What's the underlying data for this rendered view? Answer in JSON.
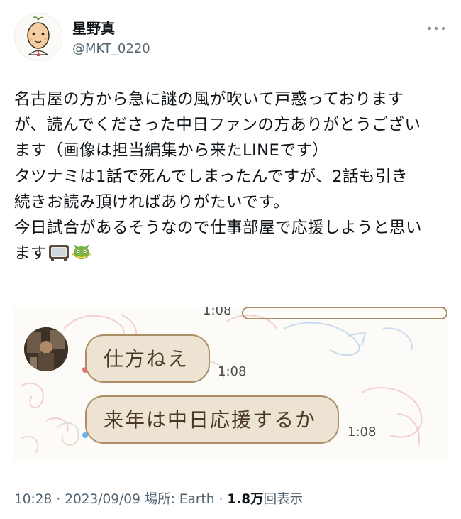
{
  "author": {
    "display_name": "星野真",
    "handle": "@MKT_0220",
    "avatar_icon": "cartoon-face-avatar"
  },
  "more_icon": "ellipsis-icon",
  "tweet": {
    "text": "名古屋の方から急に謎の風が吹いて戸惑っております\nが、読んでくださった中日ファンの方ありがとうござい\nます（画像は担当編集から来たLINEです）\nタツナミは1話で死んでしまったんですが、2話も引き\n続きお読み頂ければありがたいです。\n今日試合があるそうなので仕事部屋で応援しようと思い\nます",
    "emoji": [
      "television-emoji",
      "dragon-emoji"
    ]
  },
  "media": {
    "type": "chat-screenshot",
    "top_timestamp": "1:08",
    "messages": [
      {
        "text": "仕方ねえ",
        "time": "1:08"
      },
      {
        "text": "来年は中日応援するか",
        "time": "1:08"
      }
    ],
    "bubble_fill": "#ede3d2",
    "bubble_border": "#ad8d66",
    "background_illustration": "dragon-pattern"
  },
  "meta": {
    "time": "10:28",
    "date": "2023/09/09",
    "location_label": "場所: Earth",
    "views_count": "1.8万",
    "views_label": "回表示"
  },
  "colors": {
    "text_primary": "#0f1419",
    "text_secondary": "#536471"
  }
}
